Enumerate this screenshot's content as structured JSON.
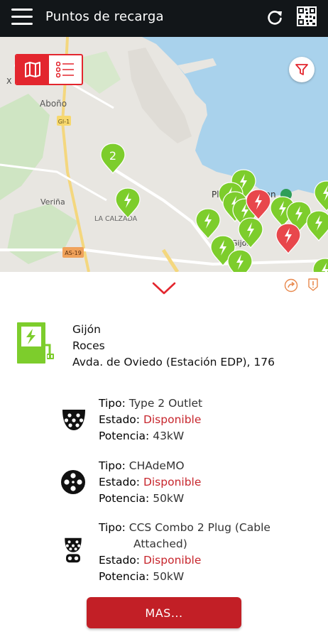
{
  "header": {
    "title": "Puntos de recarga"
  },
  "icons": {
    "menu": "hamburger-icon",
    "refresh": "refresh-icon",
    "qr": "qr-code-icon",
    "map_view": "map-icon",
    "list_view": "list-icon",
    "filter": "filter-icon",
    "collapse": "chevron-down-icon",
    "share": "share-icon",
    "report": "report-icon"
  },
  "map": {
    "labels": {
      "abono": "Aboño",
      "veriña": "Veriña",
      "calzada": "LA CALZADA",
      "gijon": "Gijón",
      "road_gi1": "GI-1",
      "road_as19": "AS-19",
      "cluster": "2",
      "x": "X",
      "pl": "Pl",
      "san": "San"
    },
    "colors": {
      "water": "#a9d2ec",
      "land": "#e8e6e1",
      "park": "#cfe5c3",
      "pin_green": "#7dcd2c",
      "pin_red": "#e8474c"
    }
  },
  "station": {
    "city": "Gijón",
    "district": "Roces",
    "address": "Avda. de Oviedo (Estación EDP), 176"
  },
  "labels": {
    "tipo": "Tipo:",
    "estado": "Estado:",
    "potencia": "Potencia:"
  },
  "connectors": [
    {
      "tipo": "Type 2 Outlet",
      "tipo2": "",
      "estado": "Disponible",
      "potencia": "43kW",
      "icon": "type2-plug-icon"
    },
    {
      "tipo": "CHAdeMO",
      "tipo2": "",
      "estado": "Disponible",
      "potencia": "50kW",
      "icon": "chademo-plug-icon"
    },
    {
      "tipo": "CCS Combo 2 Plug (Cable",
      "tipo2": "Attached)",
      "estado": "Disponible",
      "potencia": "50kW",
      "icon": "ccs-plug-icon"
    }
  ],
  "button": {
    "mas": "MAS..."
  },
  "accent": "#c21f26"
}
